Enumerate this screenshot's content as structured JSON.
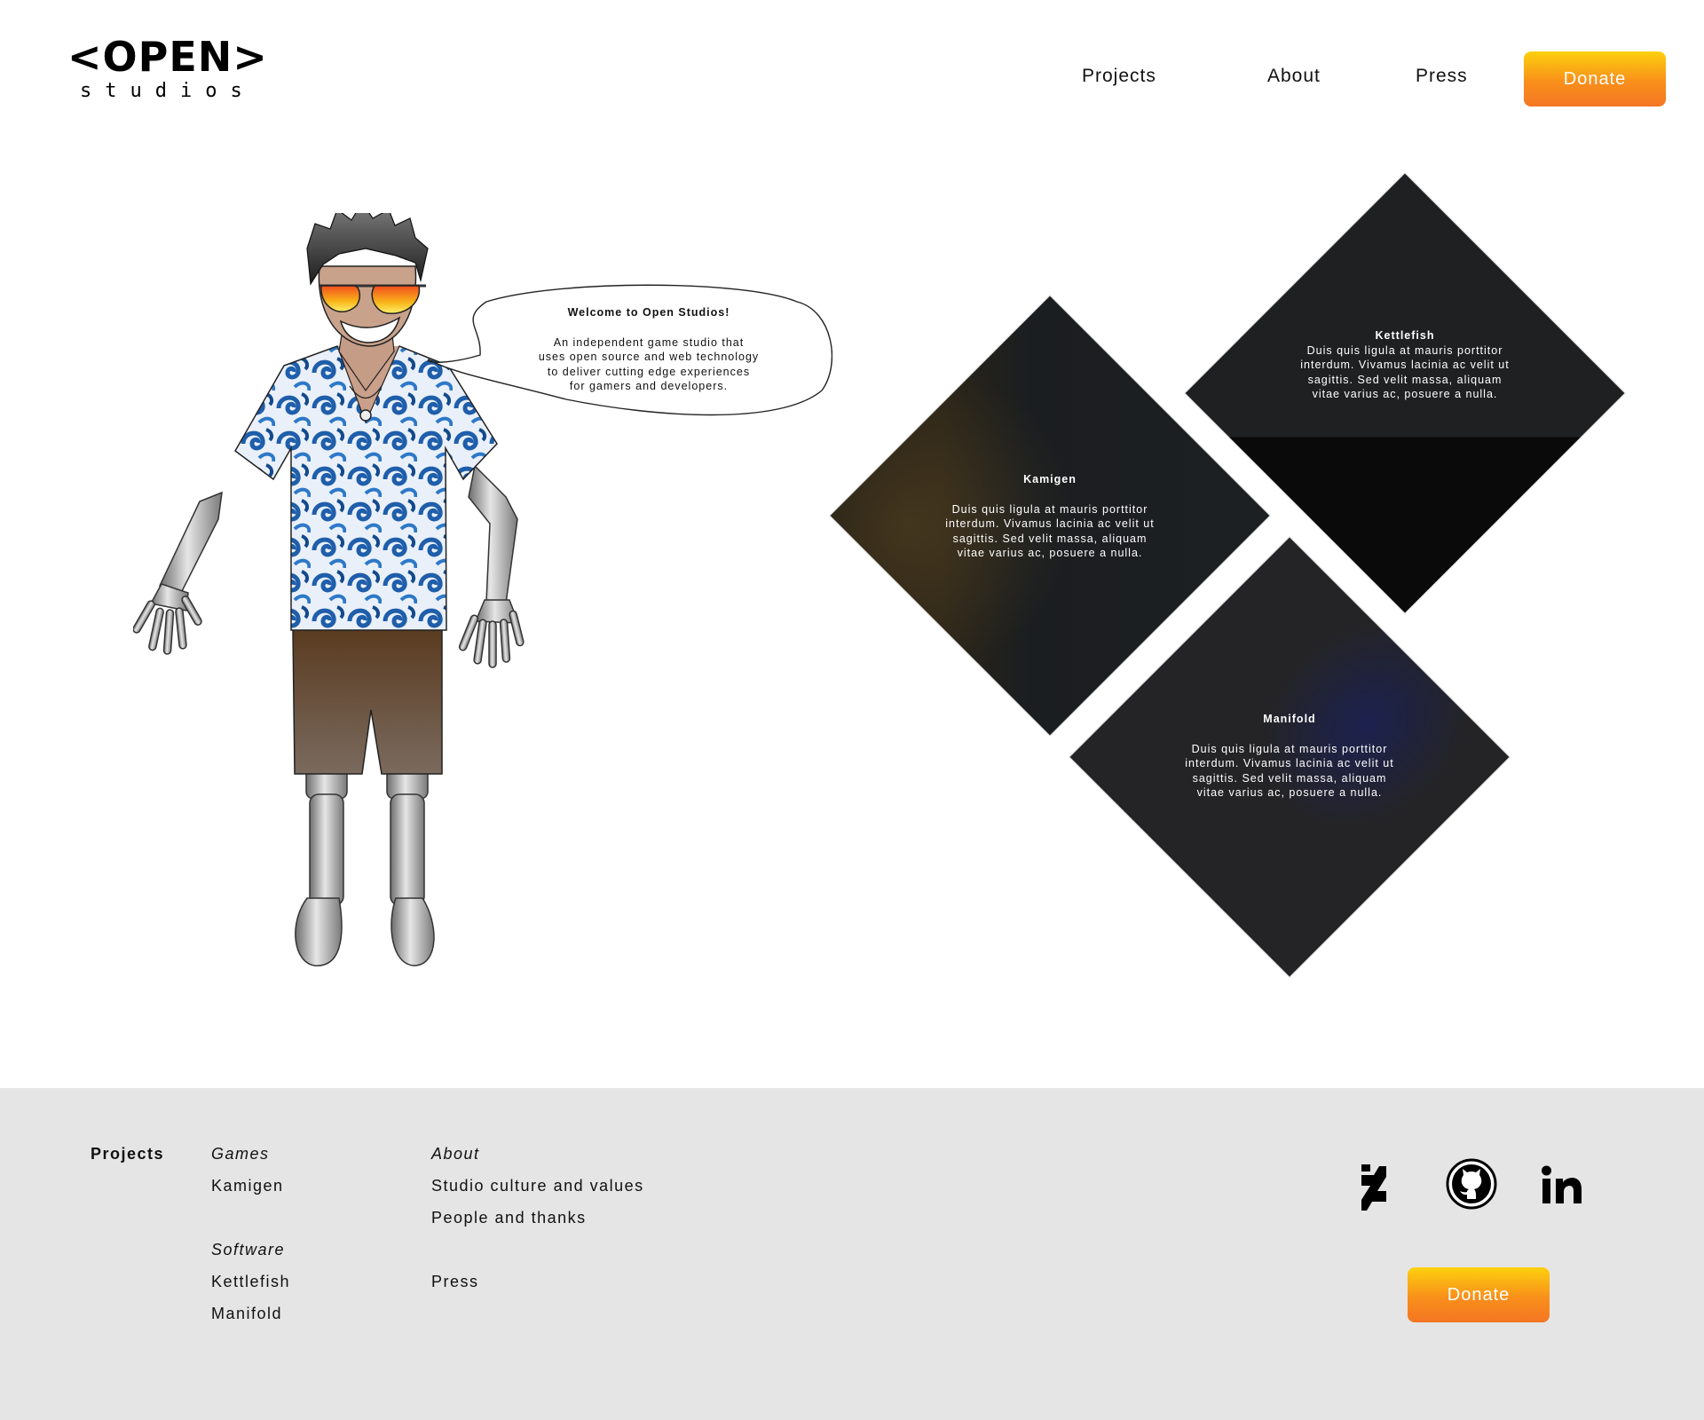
{
  "header": {
    "logo_main": "<OPEN>",
    "logo_sub": "studios",
    "nav": [
      "Projects",
      "About",
      "Press"
    ],
    "donate_label": "Donate"
  },
  "hero": {
    "bubble_title": "Welcome to Open Studios!",
    "bubble_lines": [
      "An independent game studio that",
      "uses open source and web technology",
      "to deliver cutting edge experiences",
      "for gamers and developers."
    ]
  },
  "projects": [
    {
      "name": "Kamigen",
      "lines": [
        "Duis quis ligula at mauris porttitor",
        "interdum. Vivamus lacinia ac velit ut",
        "sagittis. Sed velit massa, aliquam",
        "vitae varius ac, posuere a nulla."
      ]
    },
    {
      "name": "Kettlefish",
      "lines": [
        "Duis quis ligula at mauris porttitor",
        "interdum. Vivamus lacinia ac velit ut",
        "sagittis. Sed velit massa, aliquam",
        "vitae varius ac, posuere a nulla."
      ]
    },
    {
      "name": "Manifold",
      "lines": [
        "Duis quis ligula at mauris porttitor",
        "interdum. Vivamus lacinia ac velit ut",
        "sagittis. Sed velit massa, aliquam",
        "vitae varius ac, posuere a nulla."
      ]
    }
  ],
  "footer": {
    "projects_heading": "Projects",
    "games_heading": "Games",
    "games": [
      "Kamigen"
    ],
    "software_heading": "Software",
    "software": [
      "Kettlefish",
      "Manifold"
    ],
    "about_heading": "About",
    "about_links": [
      "Studio culture and values",
      "People and thanks"
    ],
    "press_label": "Press",
    "social_icons": [
      "deviantart-icon",
      "github-icon",
      "linkedin-icon"
    ],
    "donate_label": "Donate"
  },
  "colors": {
    "donate_gradient_top": "#fcd10d",
    "donate_gradient_bottom": "#f47623",
    "diamond_bg": "#1c1e20",
    "footer_bg": "#e5e5e5"
  }
}
